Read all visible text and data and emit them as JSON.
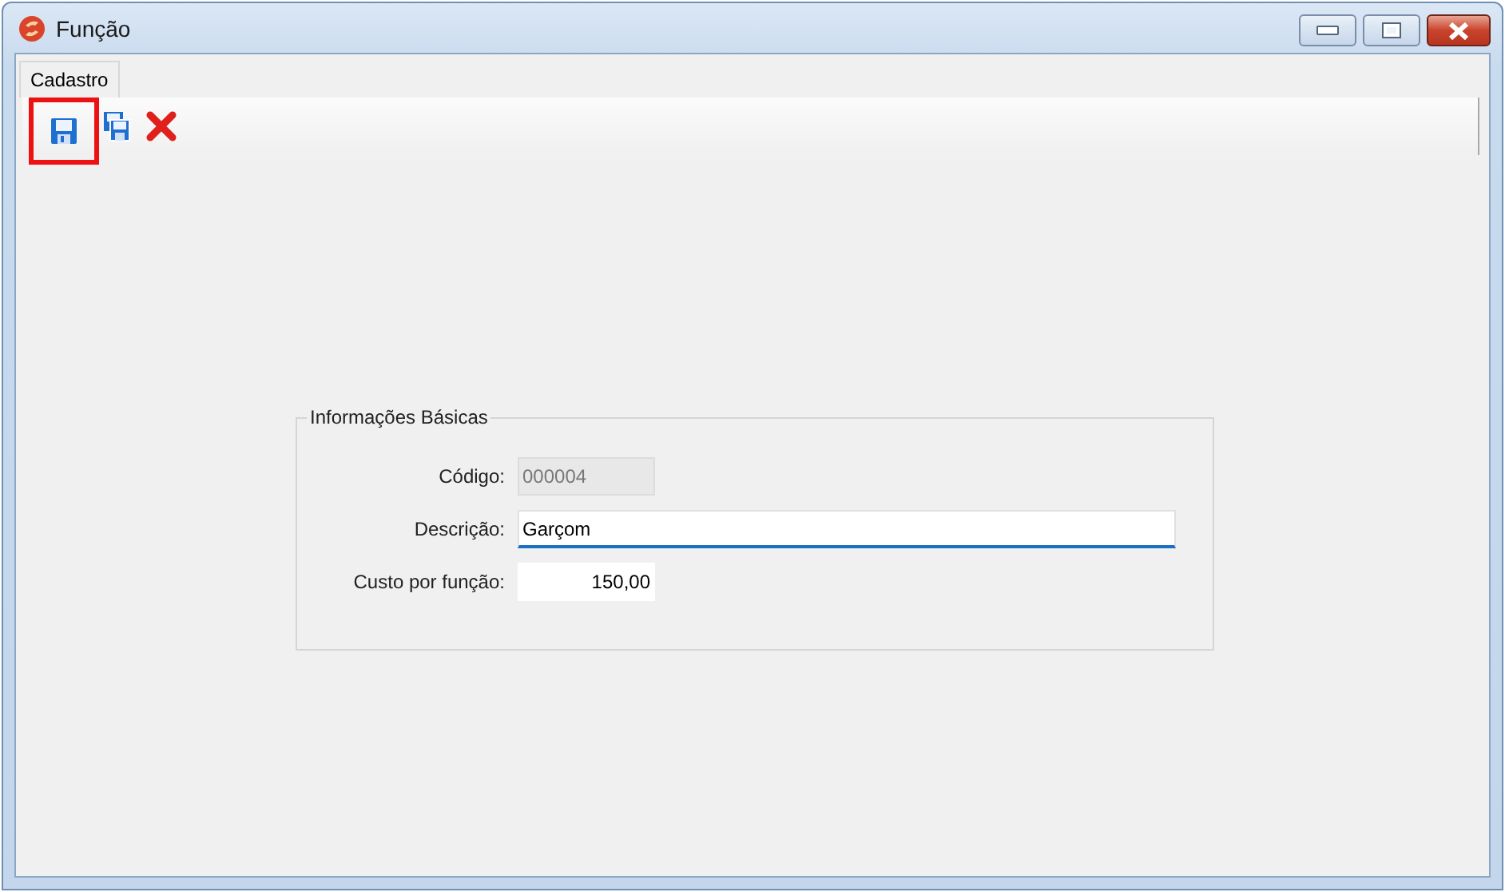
{
  "window": {
    "title": "Função"
  },
  "tabs": [
    {
      "label": "Cadastro",
      "selected": true
    }
  ],
  "toolbar": [
    {
      "kind": "save",
      "highlighted": true
    },
    {
      "kind": "save-copy",
      "highlighted": false
    },
    {
      "kind": "delete",
      "highlighted": false
    }
  ],
  "group": {
    "title": "Informações Básicas",
    "fields": [
      {
        "kind": "code",
        "label": "Código:",
        "value": "000004",
        "disabled": true,
        "focused": false
      },
      {
        "kind": "text",
        "label": "Descrição:",
        "value": "Garçom",
        "disabled": false,
        "focused": true
      },
      {
        "kind": "money",
        "label": "Custo por função:",
        "value": "150,00",
        "disabled": false,
        "focused": false
      }
    ]
  }
}
